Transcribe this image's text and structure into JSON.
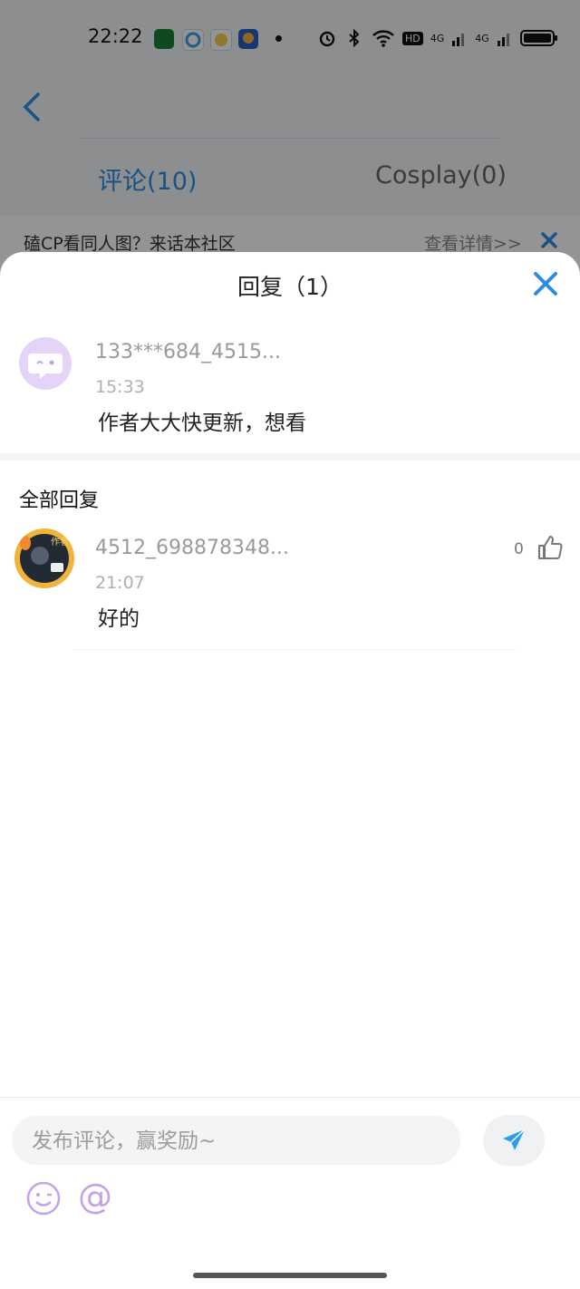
{
  "status_bar": {
    "time": "22:22",
    "network_1": "4G",
    "network_2": "4G",
    "hd_badge": "HD",
    "app_icons": [
      "oppo-app-icon",
      "browser-app-icon",
      "mascot-app-icon",
      "reader-app-icon"
    ]
  },
  "background_page": {
    "tabs": [
      {
        "label": "评论(10)",
        "active": true
      },
      {
        "label": "Cosplay(0)",
        "active": false
      }
    ],
    "banner": {
      "text": "磕CP看同人图？来话本社区",
      "link": "查看详情>>"
    }
  },
  "sheet": {
    "title": "回复（1）",
    "original_comment": {
      "username": "133***684_4515...",
      "time": "15:33",
      "content": "作者大大快更新，想看"
    },
    "section_title": "全部回复",
    "replies": [
      {
        "username": "4512_698878348...",
        "time": "21:07",
        "content": "好的",
        "likes": "0",
        "avatar_badge": "作者"
      }
    ]
  },
  "composer": {
    "placeholder": "发布评论，赢奖励~",
    "at_symbol": "@"
  },
  "colors": {
    "accent_blue": "#2d8de6",
    "send_blue": "#2a9ef0",
    "avatar_purple": "#e4d4f7",
    "icon_purple": "#c6a2e6"
  }
}
